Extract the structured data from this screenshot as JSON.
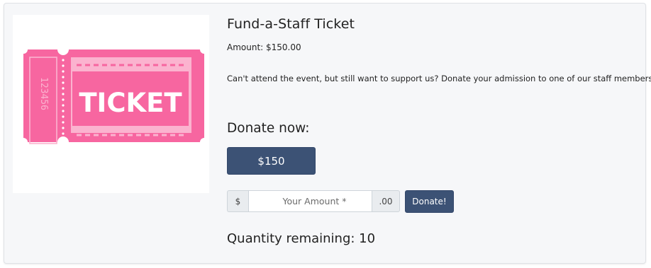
{
  "product": {
    "title": "Fund-a-Staff Ticket",
    "amount_label": "Amount: $150.00",
    "description": "Can't attend the event, but still want to support us? Donate your admission to one of our staff members!",
    "image": {
      "icon": "ticket-icon",
      "ticket_word": "TICKET",
      "ticket_number": "123456",
      "colors": {
        "pink": "#f766a0",
        "light_pink": "#fbb3cf"
      }
    }
  },
  "donate": {
    "heading": "Donate now:",
    "preset_label": "$150",
    "currency_prefix": "$",
    "amount_placeholder": "Your Amount *",
    "cents_suffix": ".00",
    "submit_label": "Donate!",
    "button_color": "#3c5275"
  },
  "quantity": {
    "label": "Quantity remaining: 10"
  }
}
